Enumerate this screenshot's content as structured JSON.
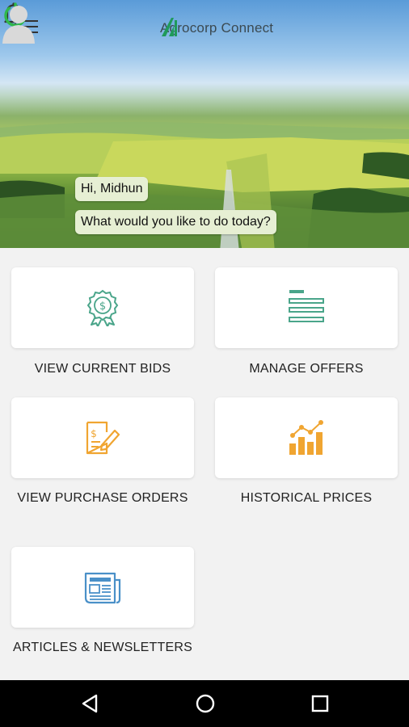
{
  "app": {
    "name": "Agrocorp Connect"
  },
  "greeting": {
    "hello": "Hi, Midhun",
    "question": "What would you like to do today?"
  },
  "tiles": [
    {
      "label": "VIEW CURRENT BIDS",
      "icon": "bid-award-icon",
      "color": "#4aa58a"
    },
    {
      "label": "MANAGE OFFERS",
      "icon": "list-lines-icon",
      "color": "#4aa58a"
    },
    {
      "label": "VIEW PURCHASE ORDERS",
      "icon": "purchase-order-icon",
      "color": "#f0a531"
    },
    {
      "label": "HISTORICAL PRICES",
      "icon": "bar-chart-icon",
      "color": "#f0a531"
    },
    {
      "label": "ARTICLES & NEWSLETTERS",
      "icon": "newspaper-icon",
      "color": "#4a90c8"
    }
  ],
  "colors": {
    "accent_green": "#2fb84a",
    "brand_text": "#3b4a52"
  },
  "nav": [
    "back-icon",
    "home-icon",
    "recents-icon"
  ]
}
